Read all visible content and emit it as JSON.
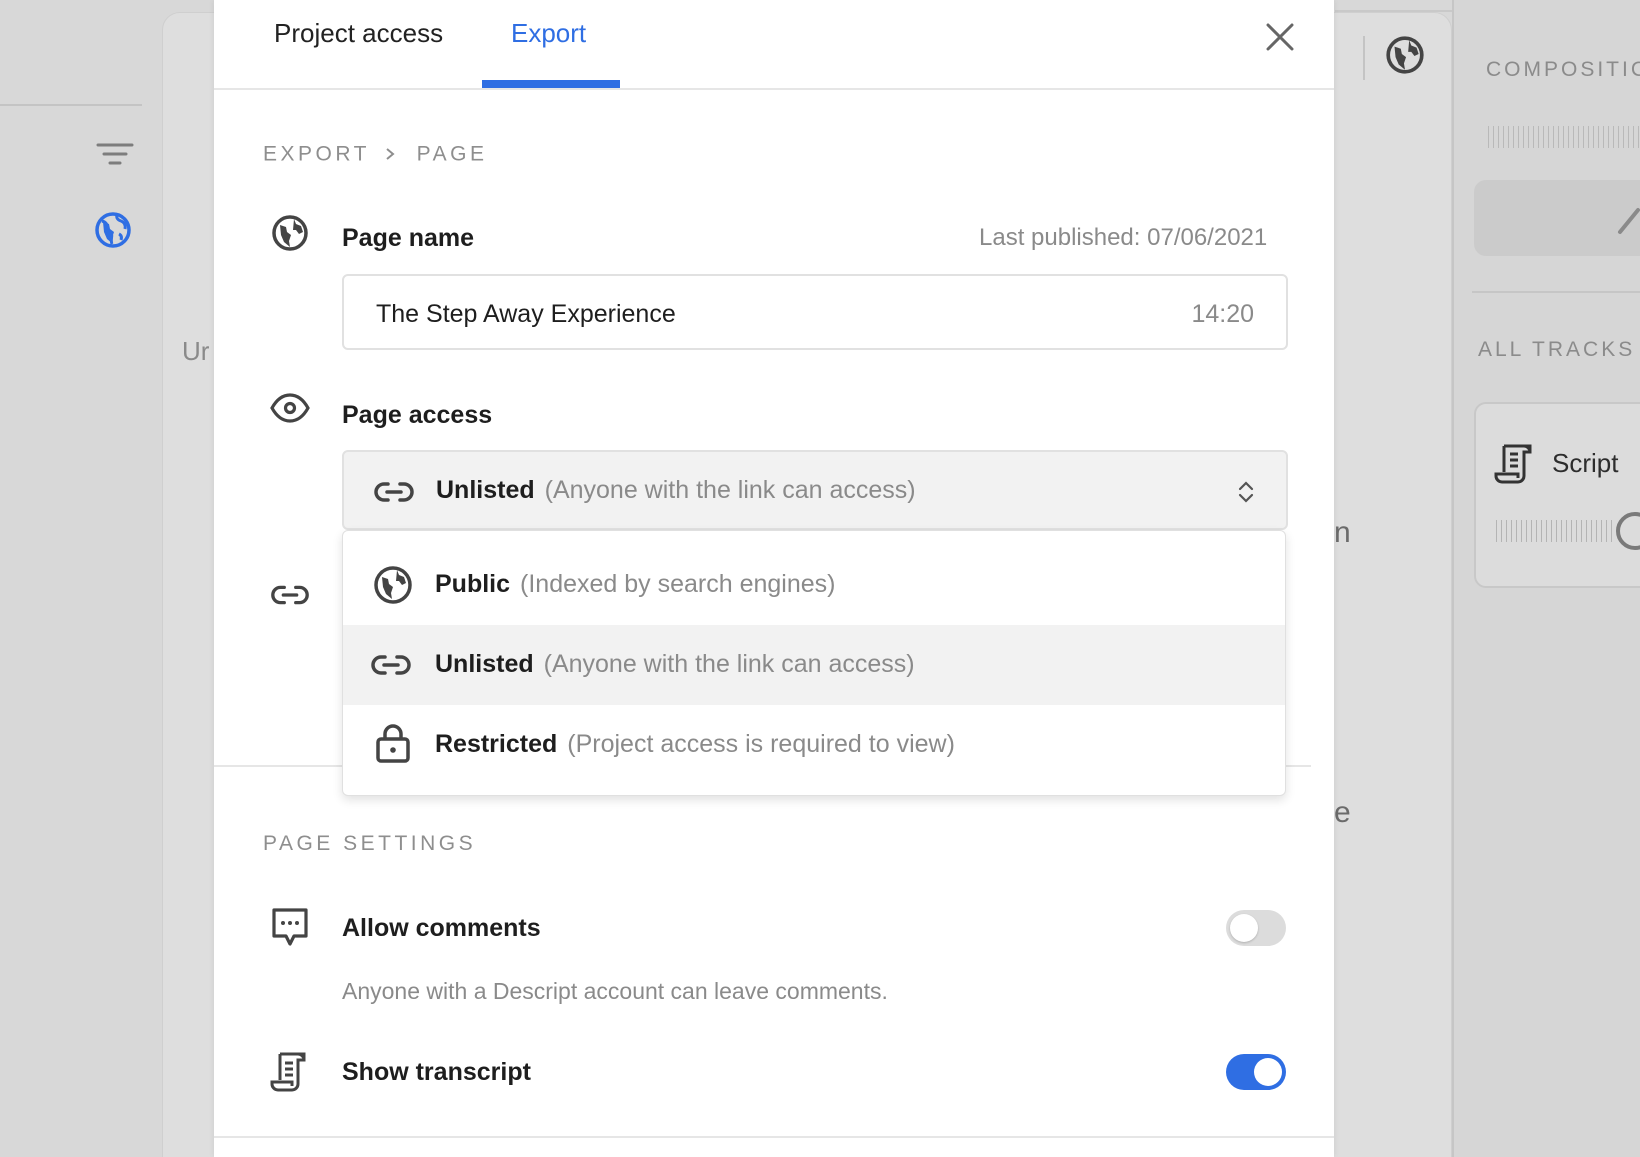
{
  "tabs": [
    {
      "label": "Project access",
      "active": false
    },
    {
      "label": "Export",
      "active": true
    }
  ],
  "breadcrumb": [
    "EXPORT",
    "PAGE"
  ],
  "page_name": {
    "label": "Page name",
    "last_published": "Last published: 07/06/2021",
    "value": "The Step Away Experience",
    "duration": "14:20"
  },
  "page_access": {
    "label": "Page access",
    "selected": {
      "name": "Unlisted",
      "hint": "(Anyone with the link can access)"
    },
    "options": [
      {
        "name": "Public",
        "hint": "(Indexed by search engines)",
        "icon": "globe-icon"
      },
      {
        "name": "Unlisted",
        "hint": "(Anyone with the link can access)",
        "icon": "link-icon",
        "highlighted": true
      },
      {
        "name": "Restricted",
        "hint": "(Project access is required to view)",
        "icon": "lock-icon"
      }
    ]
  },
  "page_settings": {
    "title": "PAGE SETTINGS",
    "allow_comments": {
      "label": "Allow comments",
      "description": "Anyone with a Descript account can leave comments.",
      "enabled": false
    },
    "show_transcript": {
      "label": "Show transcript",
      "enabled": true
    }
  },
  "background": {
    "left_text": "Ur",
    "mid_text_1": "n",
    "mid_text_2": "e",
    "composition_label": "COMPOSITIC",
    "all_tracks_label": "ALL TRACKS",
    "track_name": "Script"
  },
  "colors": {
    "accent": "#2f6ee3",
    "muted_text": "#8a8a8a",
    "text": "#1e1e1e"
  }
}
